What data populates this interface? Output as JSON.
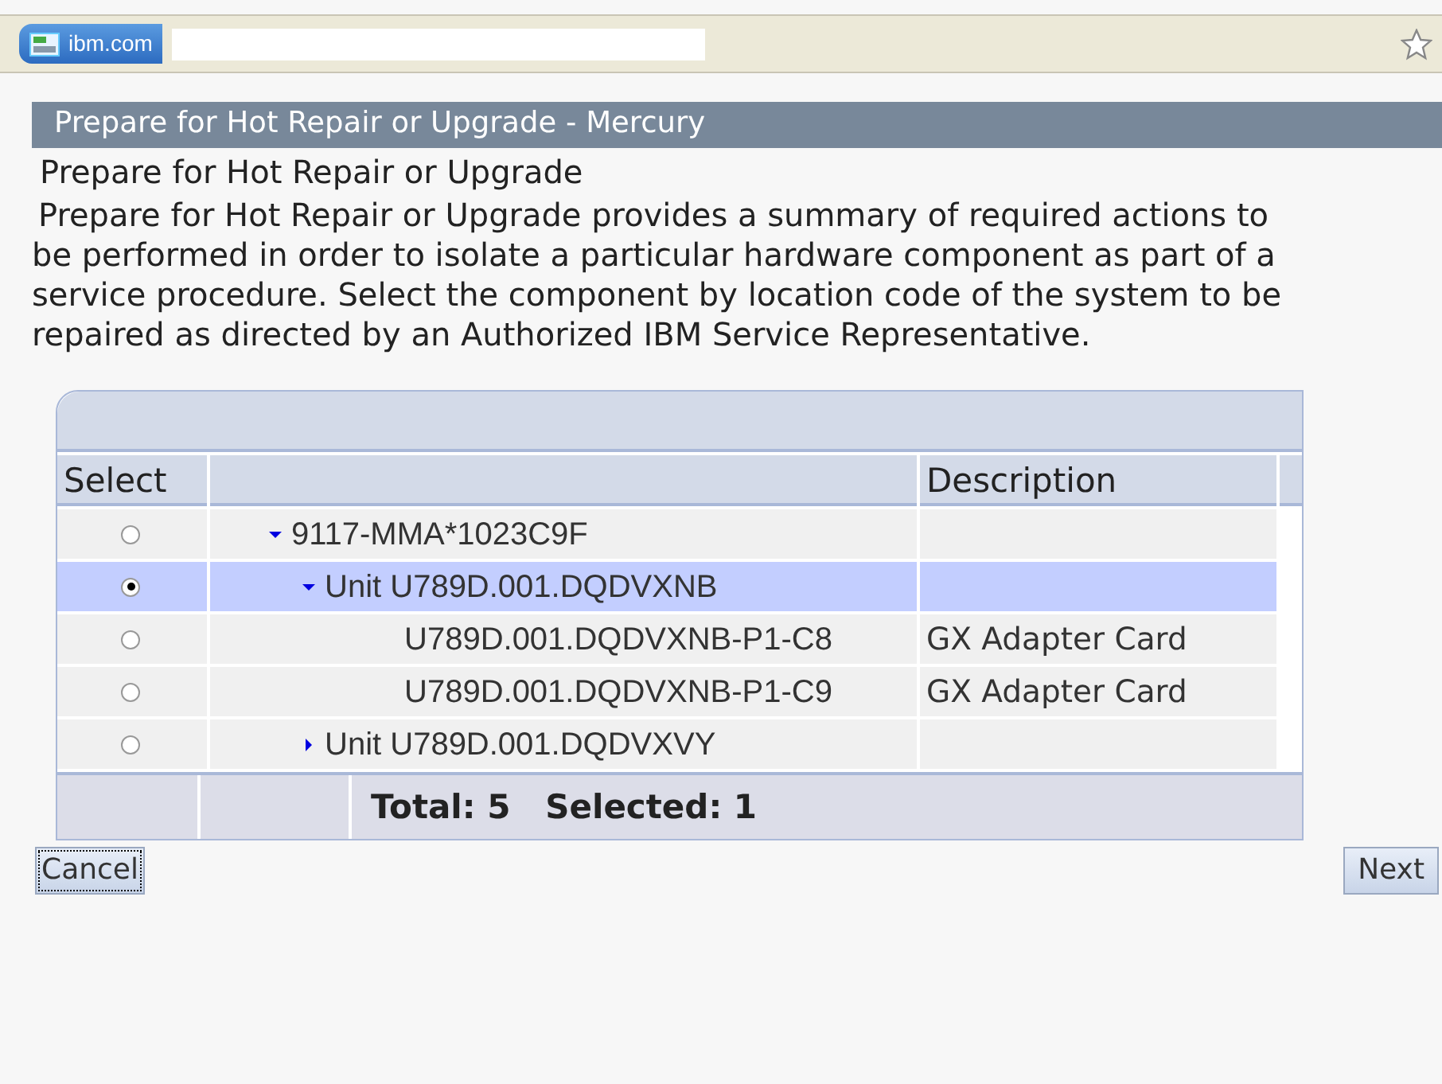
{
  "browser": {
    "site": "ibm.com"
  },
  "panel": {
    "title": "Prepare for Hot Repair or Upgrade - Mercury",
    "heading": "Prepare for Hot Repair or Upgrade",
    "description": "Prepare for Hot Repair or Upgrade provides a summary of required actions to be performed in order to isolate a particular hardware component as part of a service procedure. Select the component by location code of the system to be repaired as directed by an Authorized IBM Service Representative."
  },
  "table": {
    "columns": [
      "Select",
      "Description"
    ],
    "rows": [
      {
        "name": "9117-MMA*1023C9F",
        "selected": false,
        "expanded": true,
        "children": [
          {
            "name": "Unit U789D.001.DQDVXNB",
            "selected": true,
            "expanded": true,
            "children": [
              {
                "name": "U789D.001.DQDVXNB-P1-C8",
                "description": "GX Adapter Card",
                "selected": false
              },
              {
                "name": "U789D.001.DQDVXNB-P1-C9",
                "description": "GX Adapter Card",
                "selected": false
              }
            ]
          },
          {
            "name": "Unit U789D.001.DQDVXVY",
            "selected": false,
            "expanded": false
          }
        ]
      }
    ],
    "footer": "Total: 5   Selected: 1"
  },
  "buttons": [
    {
      "label": "Cancel",
      "kind": "focused"
    },
    {
      "label": "Next",
      "kind": "normal"
    }
  ]
}
